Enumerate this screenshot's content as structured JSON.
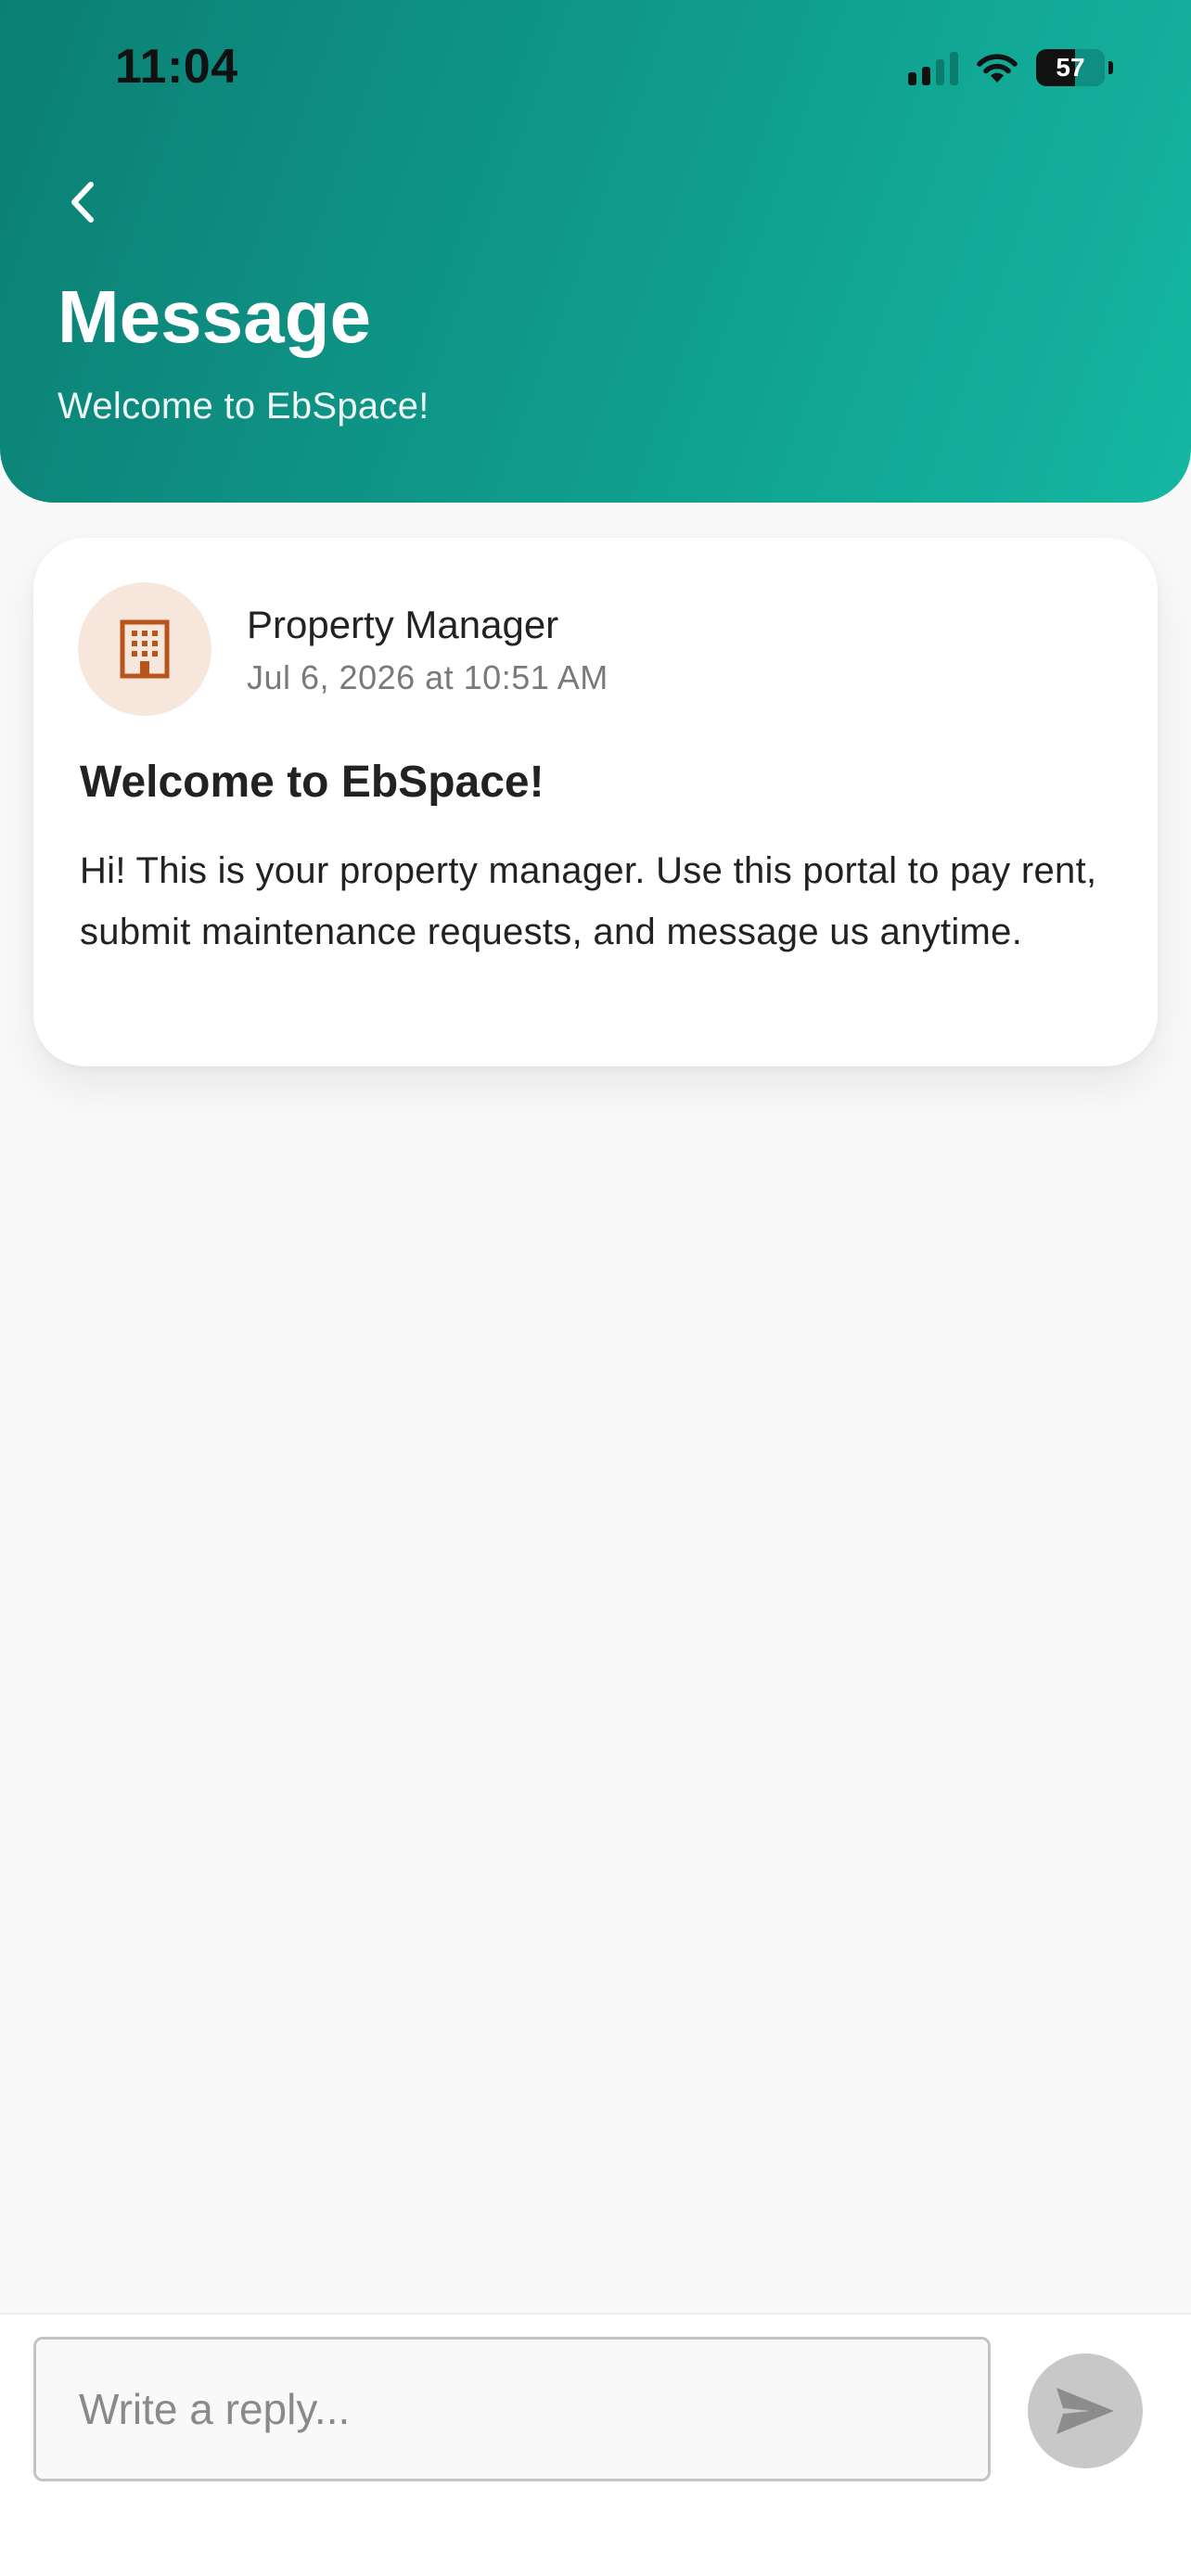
{
  "status_bar": {
    "time": "11:04",
    "battery_level": "57",
    "battery_percent": 57
  },
  "header": {
    "title": "Message",
    "subtitle": "Welcome to EbSpace!",
    "back_icon": "chevron-left-icon",
    "gradient_colors": [
      "#0c7f74",
      "#15b7a2"
    ]
  },
  "message": {
    "sender": "Property Manager",
    "timestamp": "Jul 6, 2026 at 10:51 AM",
    "avatar_icon": "building-icon",
    "avatar_bg": "#f6e6dc",
    "avatar_icon_color": "#b8531a",
    "subject": "Welcome to EbSpace!",
    "body": "Hi! This is your property manager. Use this portal to pay rent, submit maintenance requests, and message us anytime."
  },
  "reply": {
    "placeholder": "Write a reply...",
    "value": "",
    "send_icon": "send-icon"
  }
}
